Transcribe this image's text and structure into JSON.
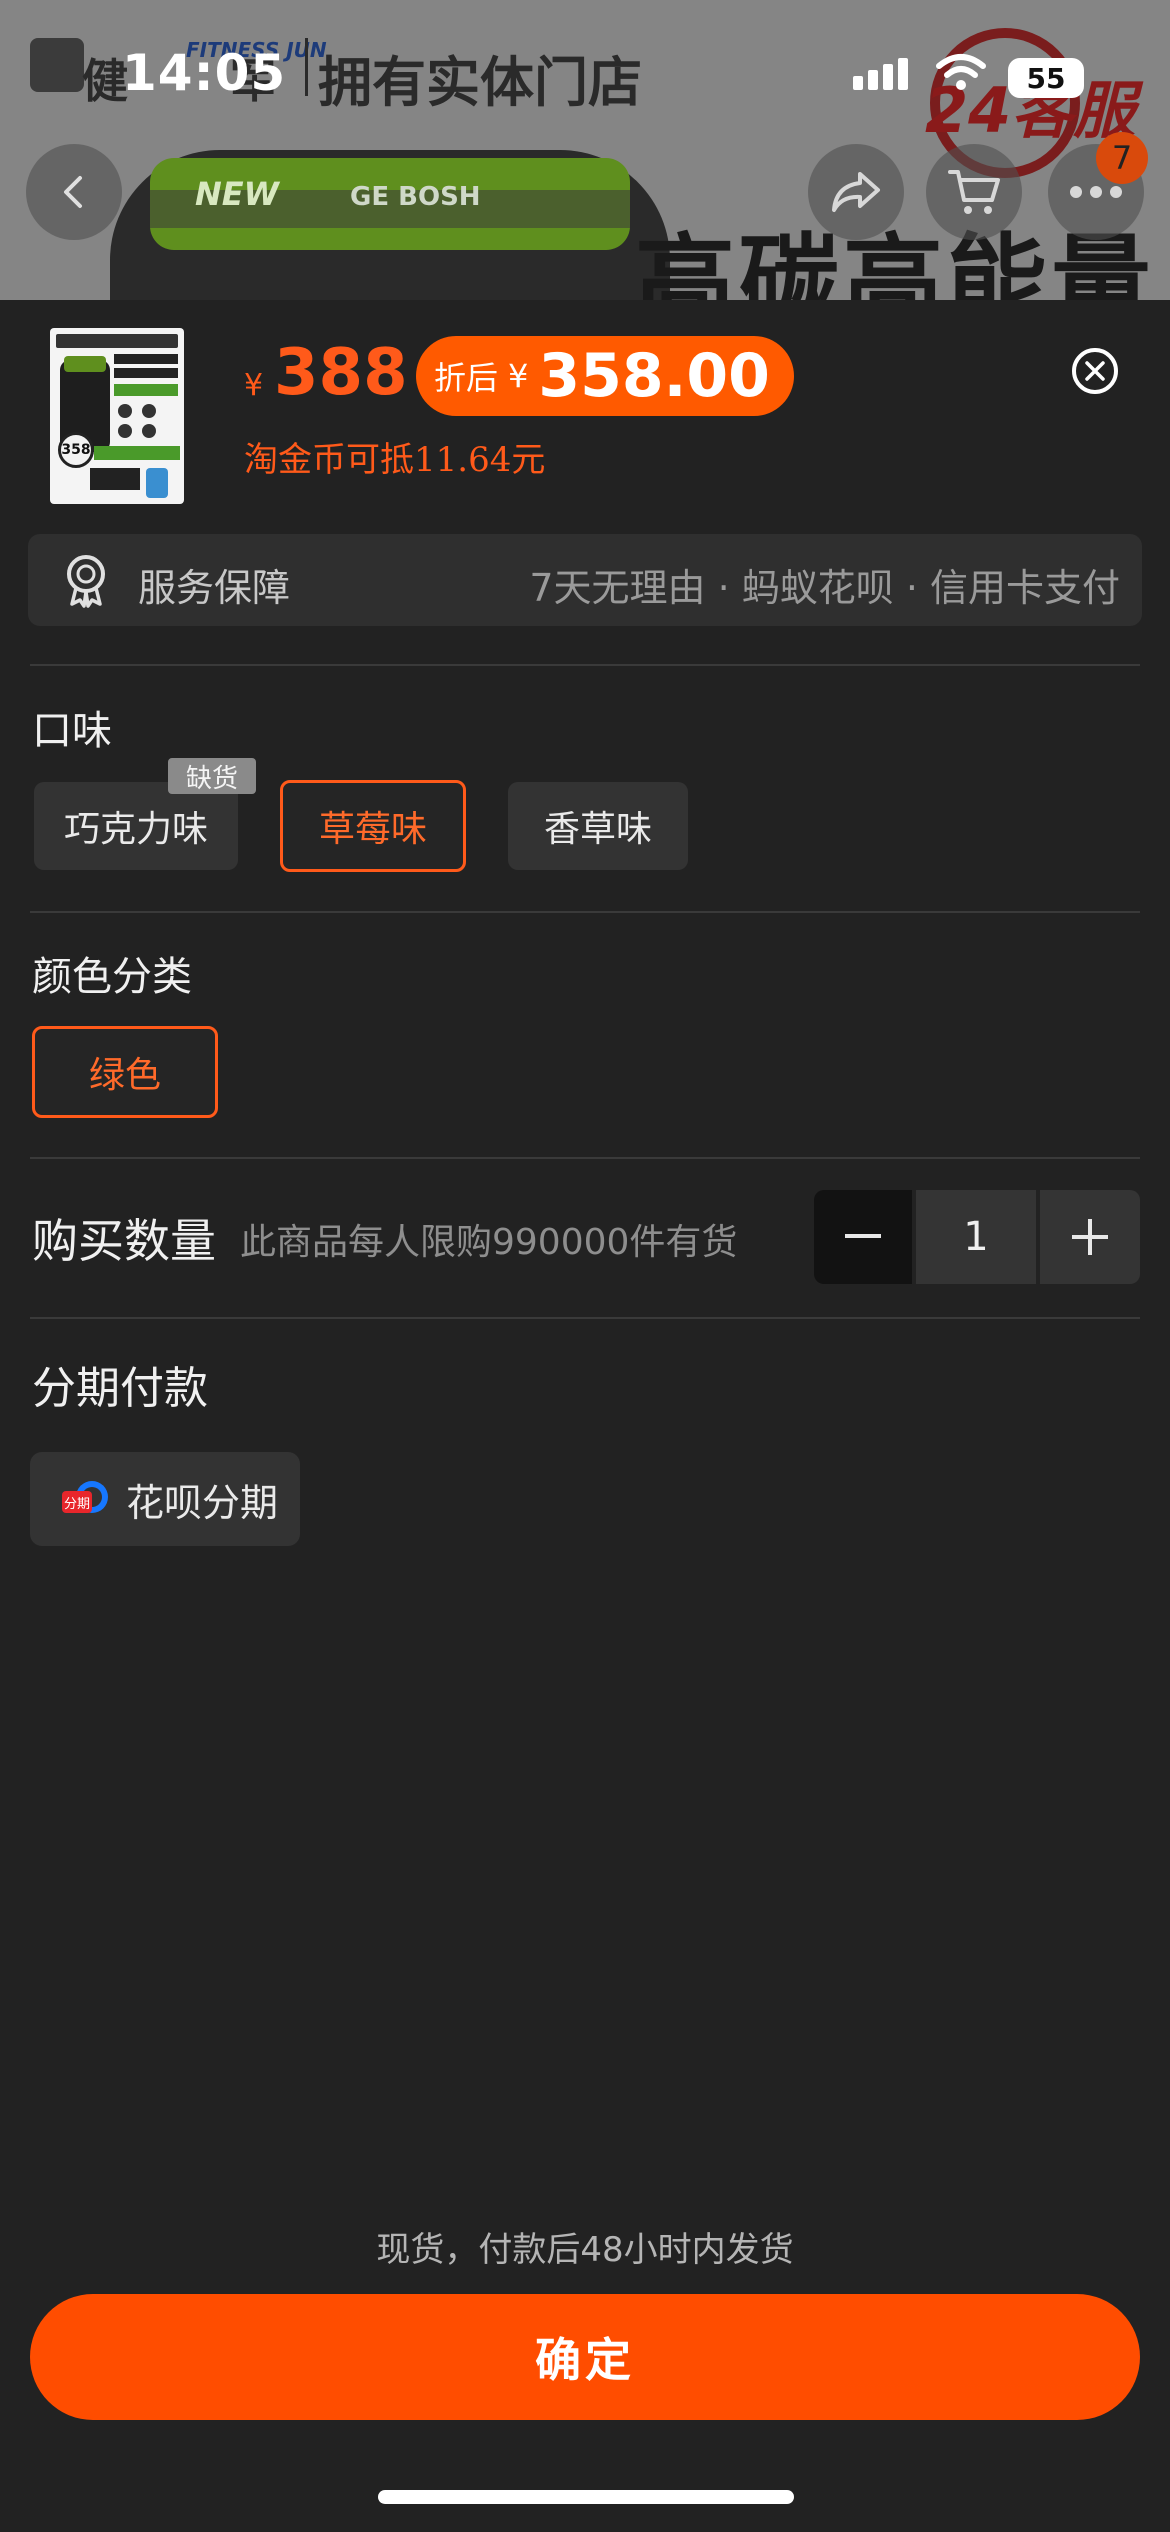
{
  "status_bar": {
    "time": "14:05",
    "battery": "55"
  },
  "banner": {
    "store_name_part1": "健",
    "store_name_part2": "军",
    "store_subtitle": "FITNESS JUN",
    "store_tagline": "拥有实体门店",
    "slogan": "高碳高能量",
    "clock_badge": "24客服",
    "jar_brand": "NEW",
    "jar_brand_2": "GE BOSH"
  },
  "top_nav": {
    "badge_count": "7"
  },
  "product": {
    "thumb_price": "358",
    "currency": "¥",
    "price": "388",
    "discount_label": "折后",
    "discount_currency": "¥",
    "discount_price": "358.00",
    "coin_note": "淘金币可抵11.64元"
  },
  "service": {
    "label": "服务保障",
    "value": "7天无理由 · 蚂蚁花呗 · 信用卡支付"
  },
  "flavor": {
    "title": "口味",
    "out_of_stock_tag": "缺货",
    "options": [
      "巧克力味",
      "草莓味",
      "香草味"
    ],
    "selected": "草莓味"
  },
  "color": {
    "title": "颜色分类",
    "options": [
      "绿色"
    ],
    "selected": "绿色"
  },
  "quantity": {
    "title": "购买数量",
    "note": "此商品每人限购990000件有货",
    "value": "1"
  },
  "installment": {
    "title": "分期付款",
    "icon_tag": "分期",
    "option": "花呗分期"
  },
  "footer": {
    "ship_note": "现货，付款后48小时内发货",
    "confirm_label": "确定"
  },
  "colors": {
    "accent": "#ff5a00",
    "sheet_bg": "#222222",
    "confirm_bg": "#ff4d00"
  }
}
